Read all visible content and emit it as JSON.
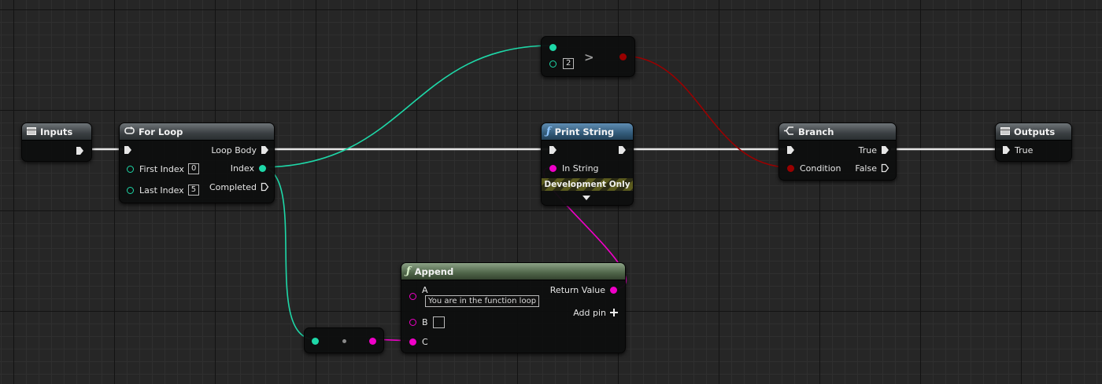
{
  "colors": {
    "exec": "#e6e6e6",
    "int": "#1ed8a8",
    "bool": "#9a0000",
    "string": "#f000c8"
  },
  "nodes": {
    "inputs": {
      "title": "Inputs",
      "icon": "struct-icon"
    },
    "for_loop": {
      "title": "For Loop",
      "icon": "loop-icon",
      "pins": {
        "loop_body": "Loop Body",
        "first_index": "First Index",
        "first_index_value": "0",
        "index": "Index",
        "last_index": "Last Index",
        "last_index_value": "5",
        "completed": "Completed"
      }
    },
    "greater": {
      "operator": ">",
      "b_value": "2"
    },
    "print_string": {
      "title": "Print String",
      "icon": "function-icon",
      "pins": {
        "in_string": "In String"
      },
      "dev_only": "Development Only"
    },
    "branch": {
      "title": "Branch",
      "icon": "branch-icon",
      "pins": {
        "true": "True",
        "condition": "Condition",
        "false": "False"
      }
    },
    "outputs": {
      "title": "Outputs",
      "icon": "struct-icon",
      "pins": {
        "true": "True"
      }
    },
    "append": {
      "title": "Append",
      "icon": "function-icon",
      "pins": {
        "a": "A",
        "a_value": "You are in the function loop",
        "return_value": "Return Value",
        "add_pin": "Add pin",
        "b": "B",
        "c": "C"
      }
    }
  }
}
